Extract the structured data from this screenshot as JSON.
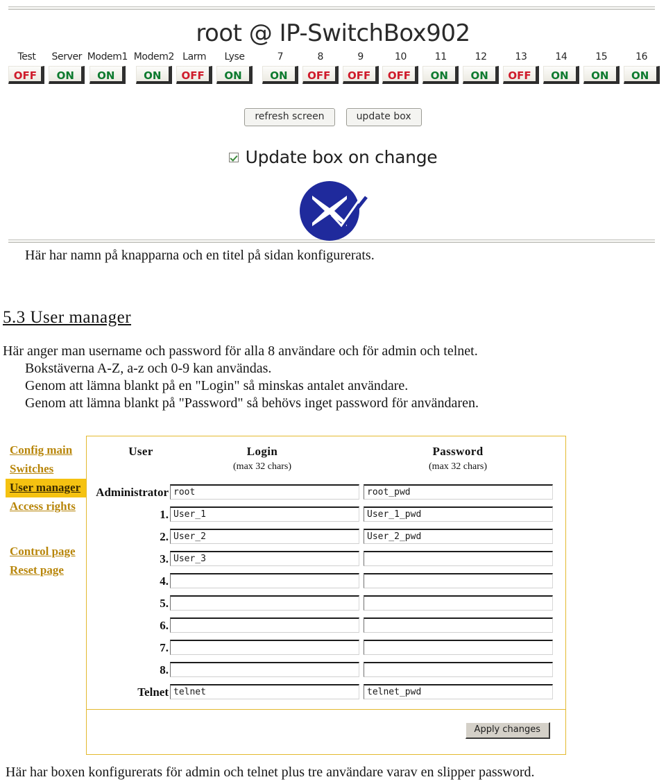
{
  "rules": {
    "top": "",
    "mid": ""
  },
  "switch_page": {
    "title": "root @ IP-SwitchBox902",
    "switches": [
      {
        "label": "Test",
        "state": "OFF"
      },
      {
        "label": "Server",
        "state": "ON"
      },
      {
        "label": "Modem1",
        "state": "ON"
      },
      {
        "label": "Modem2",
        "state": "ON"
      },
      {
        "label": "Larm",
        "state": "OFF"
      },
      {
        "label": "Lyse",
        "state": "ON"
      },
      {
        "label": "7",
        "state": "ON"
      },
      {
        "label": "8",
        "state": "OFF"
      },
      {
        "label": "9",
        "state": "OFF"
      },
      {
        "label": "10",
        "state": "OFF"
      },
      {
        "label": "11",
        "state": "ON"
      },
      {
        "label": "12",
        "state": "ON"
      },
      {
        "label": "13",
        "state": "OFF"
      },
      {
        "label": "14",
        "state": "ON"
      },
      {
        "label": "15",
        "state": "ON"
      },
      {
        "label": "16",
        "state": "ON"
      }
    ],
    "refresh_label": "refresh screen",
    "update_label": "update box",
    "checkbox_label": "Update box on change",
    "checkbox_checked": true,
    "logo_name": "blue-circle-x-check-logo"
  },
  "document": {
    "caption_top": "Här har namn på knapparna och en titel på sidan konfigurerats.",
    "heading": "5.3 User manager",
    "paragraph": [
      "Här anger man username och password för alla 8 användare och för admin och telnet.",
      "Bokstäverna A-Z, a-z och 0-9 kan användas.",
      "Genom att lämna blankt på en \"Login\" så minskas antalet användare.",
      "Genom att lämna blankt på \"Password\" så behövs inget password för användaren."
    ],
    "caption_bottom": "Här har boxen konfigurerats för admin och telnet plus tre användare varav en slipper password."
  },
  "user_manager": {
    "nav": [
      {
        "label": "Config main",
        "active": false
      },
      {
        "label": "Switches",
        "active": false
      },
      {
        "label": "User manager",
        "active": true
      },
      {
        "label": "Access rights",
        "active": false
      },
      {
        "label": "Control page",
        "active": false
      },
      {
        "label": "Reset page",
        "active": false
      }
    ],
    "headers": {
      "user": "User",
      "login": "Login",
      "login_hint": "(max 32 chars)",
      "password": "Password",
      "password_hint": "(max 32 chars)"
    },
    "rows": [
      {
        "label": "Administrator",
        "login": "root",
        "password": "root_pwd"
      },
      {
        "label": "1.",
        "login": "User_1",
        "password": "User_1_pwd"
      },
      {
        "label": "2.",
        "login": "User_2",
        "password": "User_2_pwd"
      },
      {
        "label": "3.",
        "login": "User_3",
        "password": ""
      },
      {
        "label": "4.",
        "login": "",
        "password": ""
      },
      {
        "label": "5.",
        "login": "",
        "password": ""
      },
      {
        "label": "6.",
        "login": "",
        "password": ""
      },
      {
        "label": "7.",
        "login": "",
        "password": ""
      },
      {
        "label": "8.",
        "login": "",
        "password": ""
      },
      {
        "label": "Telnet",
        "login": "telnet",
        "password": "telnet_pwd"
      }
    ],
    "apply_label": "Apply changes",
    "accent_color": "#e3b92e",
    "highlight_color": "#f5c211",
    "link_color": "#b8860b"
  }
}
